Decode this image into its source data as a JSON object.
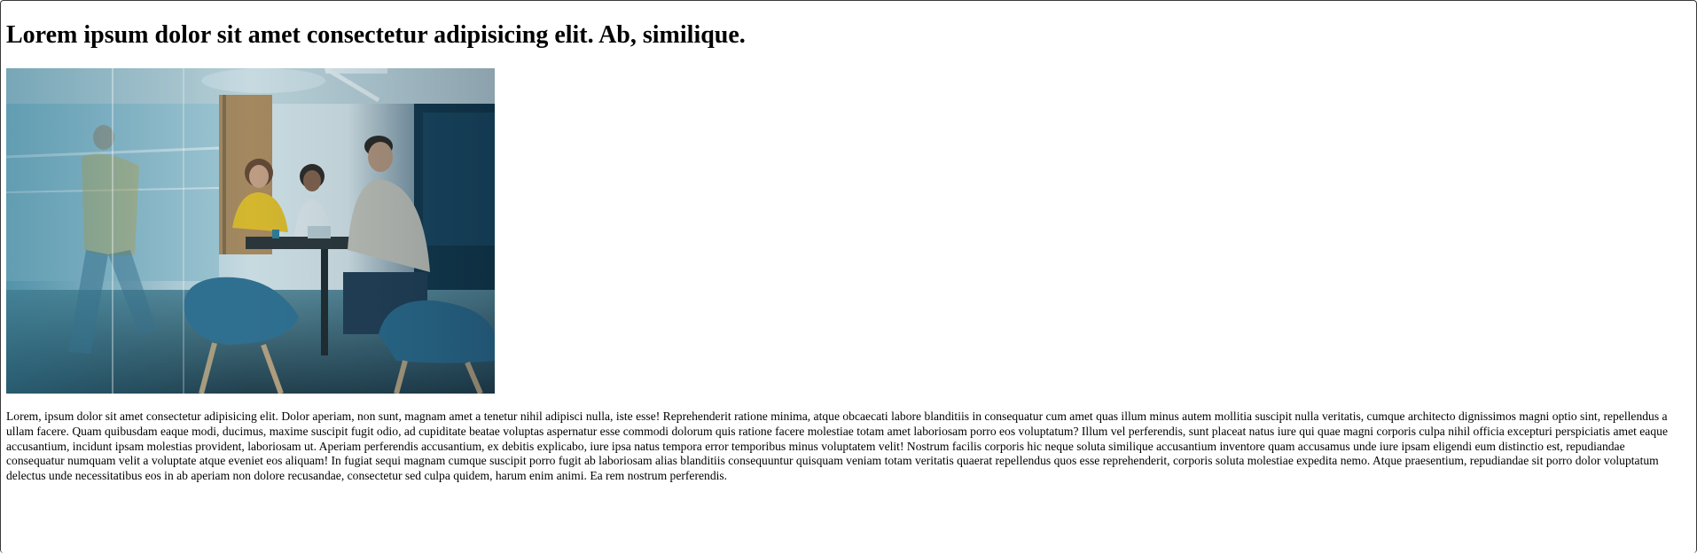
{
  "page": {
    "heading": "Lorem ipsum dolor sit amet consectetur adipisicing elit. Ab, similique.",
    "paragraph": "Lorem, ipsum dolor sit amet consectetur adipisicing elit. Dolor aperiam, non sunt, magnam amet a tenetur nihil adipisci nulla, iste esse! Reprehenderit ratione minima, atque obcaecati labore blanditiis in consequatur cum amet quas illum minus autem mollitia suscipit nulla veritatis, cumque architecto dignissimos magni optio sint, repellendus a ullam facere. Quam quibusdam eaque modi, ducimus, maxime suscipit fugit odio, ad cupiditate beatae voluptas aspernatur esse commodi dolorum quis ratione facere molestiae totam amet laboriosam porro eos voluptatum? Illum vel perferendis, sunt placeat natus iure qui quae magni corporis culpa nihil officia excepturi perspiciatis amet eaque accusantium, incidunt ipsam molestias provident, laboriosam ut. Aperiam perferendis accusantium, ex debitis explicabo, iure ipsa natus tempora error temporibus minus voluptatem velit! Nostrum facilis corporis hic neque soluta similique accusantium inventore quam accusamus unde iure ipsam eligendi eum distinctio est, repudiandae consequatur numquam velit a voluptate atque eveniet eos aliquam! In fugiat sequi magnam cumque suscipit porro fugit ab laboriosam alias blanditiis consequuntur quisquam veniam totam veritatis quaerat repellendus quos esse reprehenderit, corporis soluta molestiae expedita nemo. Atque praesentium, repudiandae sit porro dolor voluptatum delectus unde necessitatibus eos in ab aperiam non dolore recusandae, consectetur sed culpa quidem, harum enim animi. Ea rem nostrum perferendis."
  },
  "image": {
    "subject": "office meeting photo",
    "colors": {
      "glass": "#3f7f96",
      "floor": "#27404c",
      "chair": "#2f6d8f",
      "shirt_yellow": "#f2c21c",
      "wall": "#e8eef0"
    }
  }
}
